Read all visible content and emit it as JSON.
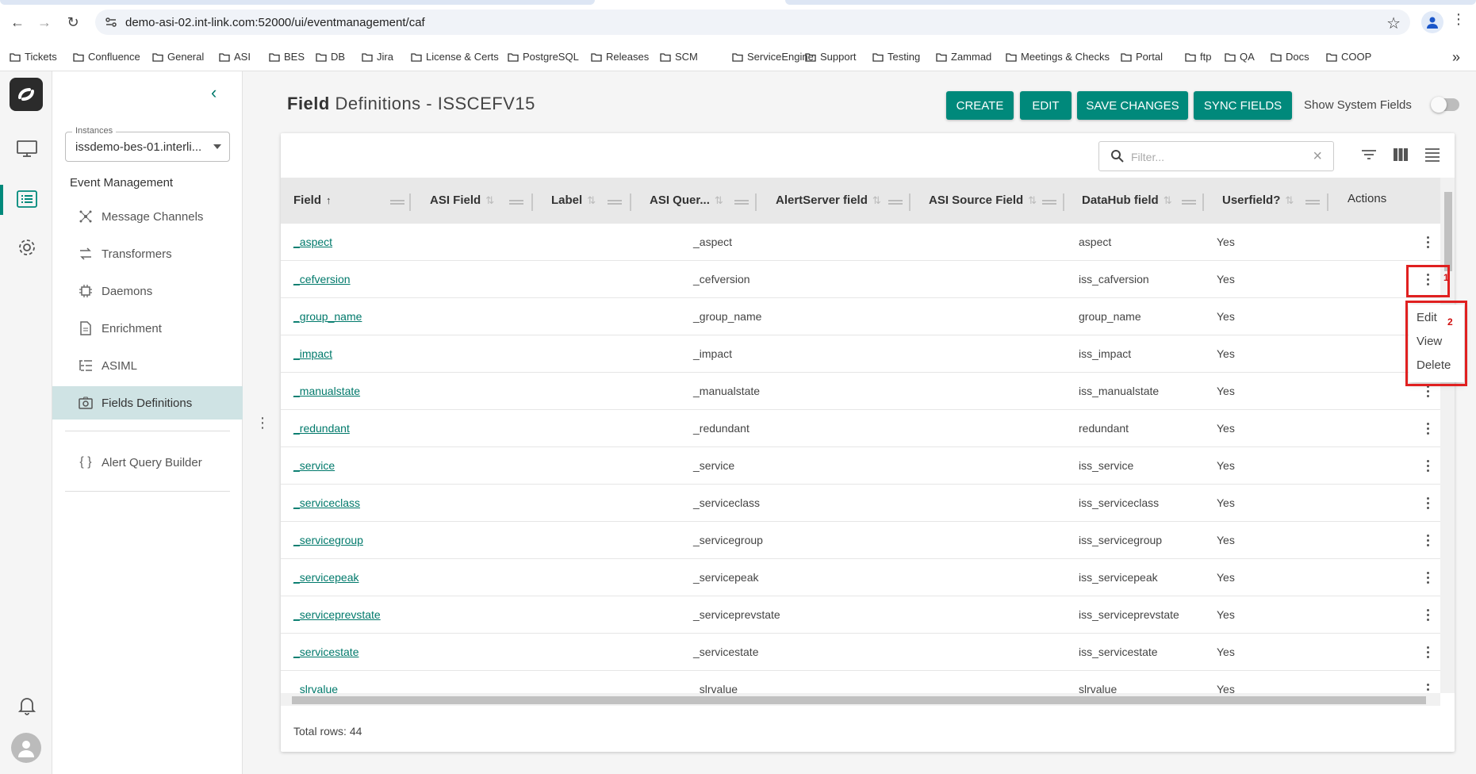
{
  "browser": {
    "url": "demo-asi-02.int-link.com:52000/ui/eventmanagement/caf",
    "bookmarks": [
      "Tickets",
      "Confluence",
      "General",
      "ASI",
      "BES",
      "DB",
      "Jira",
      "License & Certs",
      "PostgreSQL",
      "Releases",
      "SCM",
      "ServiceEngine",
      "Support",
      "Testing",
      "Zammad",
      "Meetings & Checks",
      "Portal",
      "ftp",
      "QA",
      "Docs",
      "COOP"
    ]
  },
  "sidebar": {
    "instances_label": "Instances",
    "instance_value": "issdemo-bes-01.interli...",
    "section_title": "Event Management",
    "items": [
      {
        "label": "Message Channels",
        "icon": "hub-icon"
      },
      {
        "label": "Transformers",
        "icon": "transform-icon"
      },
      {
        "label": "Daemons",
        "icon": "chip-icon"
      },
      {
        "label": "Enrichment",
        "icon": "document-icon"
      },
      {
        "label": "ASIML",
        "icon": "list-tree-icon"
      },
      {
        "label": "Fields Definitions",
        "icon": "camera-icon",
        "active": true
      },
      {
        "label": "Alert Query Builder",
        "icon": "braces-icon"
      }
    ]
  },
  "header": {
    "title_bold": "Field",
    "title_rest": " Definitions - ISSCEFV15",
    "buttons": {
      "create": "CREATE",
      "edit": "EDIT",
      "save": "SAVE CHANGES",
      "sync": "SYNC FIELDS"
    },
    "show_system_fields": "Show System Fields",
    "show_system_fields_on": false
  },
  "toolbar": {
    "filter_placeholder": "Filter..."
  },
  "table": {
    "columns": [
      "Field",
      "ASI Field",
      "Label",
      "ASI Quer...",
      "AlertServer field",
      "ASI Source Field",
      "DataHub field",
      "Userfield?",
      "Actions"
    ],
    "rows": [
      {
        "field": "_aspect",
        "alertserver": "_aspect",
        "datahub": "aspect",
        "userfield": "Yes"
      },
      {
        "field": "_cefversion",
        "alertserver": "_cefversion",
        "datahub": "iss_cafversion",
        "userfield": "Yes"
      },
      {
        "field": "_group_name",
        "alertserver": "_group_name",
        "datahub": "group_name",
        "userfield": "Yes"
      },
      {
        "field": "_impact",
        "alertserver": "_impact",
        "datahub": "iss_impact",
        "userfield": "Yes"
      },
      {
        "field": "_manualstate",
        "alertserver": "_manualstate",
        "datahub": "iss_manualstate",
        "userfield": "Yes"
      },
      {
        "field": "_redundant",
        "alertserver": "_redundant",
        "datahub": "redundant",
        "userfield": "Yes"
      },
      {
        "field": "_service",
        "alertserver": "_service",
        "datahub": "iss_service",
        "userfield": "Yes"
      },
      {
        "field": "_serviceclass",
        "alertserver": "_serviceclass",
        "datahub": "iss_serviceclass",
        "userfield": "Yes"
      },
      {
        "field": "_servicegroup",
        "alertserver": "_servicegroup",
        "datahub": "iss_servicegroup",
        "userfield": "Yes"
      },
      {
        "field": "_servicepeak",
        "alertserver": "_servicepeak",
        "datahub": "iss_servicepeak",
        "userfield": "Yes"
      },
      {
        "field": "_serviceprevstate",
        "alertserver": "_serviceprevstate",
        "datahub": "iss_serviceprevstate",
        "userfield": "Yes"
      },
      {
        "field": "_servicestate",
        "alertserver": "_servicestate",
        "datahub": "iss_servicestate",
        "userfield": "Yes"
      },
      {
        "field": "_slrvalue",
        "alertserver": "_slrvalue",
        "datahub": "slrvalue",
        "userfield": "Yes"
      }
    ],
    "total_label": "Total rows:",
    "total_value": "44"
  },
  "context_menu": {
    "items": [
      "Edit",
      "View",
      "Delete"
    ]
  },
  "annotations": {
    "marker1": "1",
    "marker2": "2"
  },
  "colors": {
    "accent": "#00897b",
    "annotation": "#e02020"
  }
}
